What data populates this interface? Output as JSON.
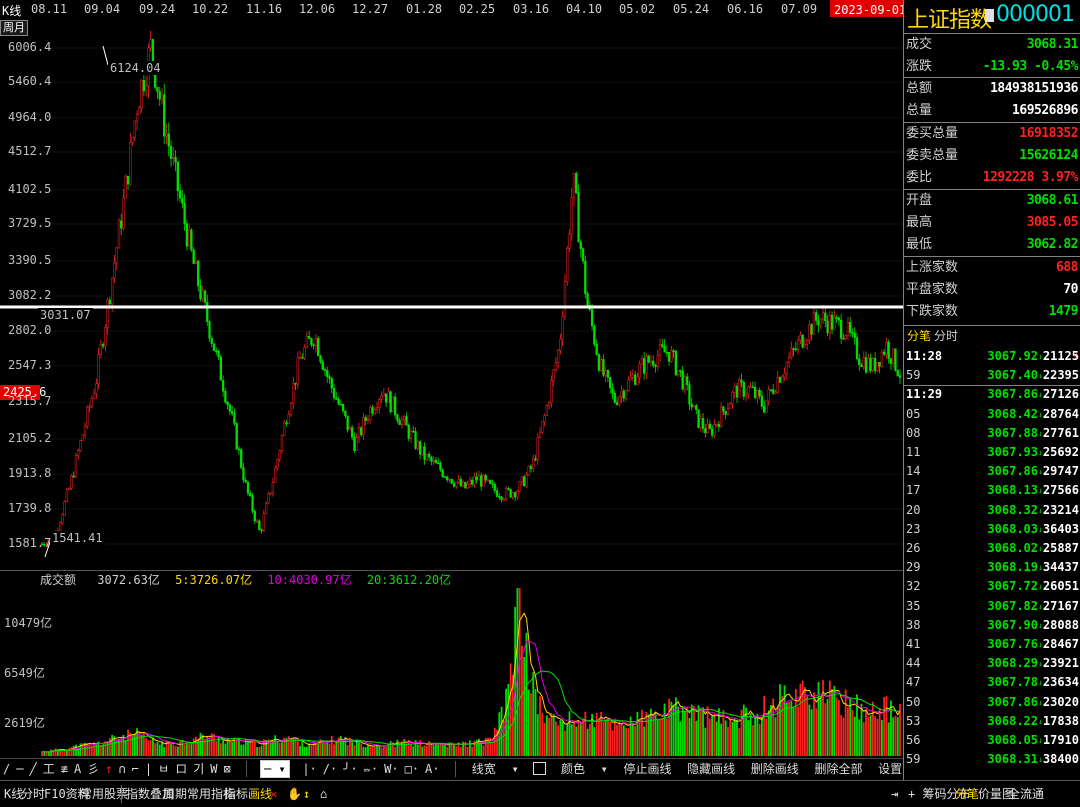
{
  "header": {
    "k_label": "K线",
    "dates": [
      "08.11",
      "09.04",
      "09.24",
      "10.22",
      "11.16",
      "12.06",
      "12.27",
      "01.28",
      "02.25",
      "03.16",
      "04.10",
      "05.02",
      "05.24",
      "06.16",
      "07.09"
    ],
    "date_stamp": "2023-09-01 五",
    "period_label": "周月"
  },
  "chart_data": [
    {
      "type": "candlestick",
      "y_ticks": [
        "6006.4",
        "5460.4",
        "4964.0",
        "4512.7",
        "4102.5",
        "3729.5",
        "3390.5",
        "3082.2",
        "2802.0",
        "2547.3",
        "2315.7",
        "2105.2",
        "1913.8",
        "1739.8",
        "1581.7"
      ],
      "high_label": "6124.04",
      "low_label": "1541.41",
      "line_label": "3031.07",
      "current_label": "2425.6",
      "h_line_value": 3031.07,
      "close_series": [
        1600,
        1700,
        2100,
        2600,
        3100,
        3900,
        4700,
        5600,
        6100,
        5400,
        4800,
        4200,
        3700,
        3200,
        2700,
        2100,
        1700,
        2200,
        2800,
        3300,
        3500,
        3100,
        2800,
        2500,
        2800,
        3000,
        2800,
        2600,
        2400,
        2300,
        2200,
        2100,
        2200,
        2100,
        2050,
        2100,
        2300,
        2800,
        3400,
        4900,
        3800,
        3200,
        2900,
        3050,
        3200,
        3300,
        3350,
        3100,
        2750,
        2600,
        2800,
        3000,
        3000,
        2850,
        3100,
        3300,
        3500,
        3650,
        3600,
        3550,
        3300,
        3200,
        3400,
        3150
      ]
    },
    {
      "type": "bar",
      "title": "成交额",
      "current": "3072.63亿",
      "ma5": "5:3726.07亿",
      "ma10": "10:4030.97亿",
      "ma20": "20:3612.20亿",
      "y_ticks": [
        "10479亿",
        "6549亿",
        "2619亿"
      ],
      "volume_series": [
        300,
        450,
        600,
        800,
        900,
        1200,
        1500,
        1600,
        1100,
        900,
        1000,
        1200,
        1500,
        1300,
        1100,
        1000,
        900,
        1200,
        1400,
        1000,
        900,
        1100,
        1300,
        1000,
        900,
        800,
        950,
        1000,
        900,
        850,
        800,
        900,
        1000,
        1200,
        3500,
        11500,
        5000,
        2800,
        2500,
        2600,
        2700,
        2600,
        2400,
        2500,
        2700,
        3000,
        3300,
        3500,
        3200,
        2900,
        2700,
        2800,
        3100,
        3500,
        4200,
        4600,
        4800,
        4500,
        4300,
        3900,
        3600,
        3300,
        3500,
        3000
      ]
    }
  ],
  "draw_toolbar": {
    "tools": [
      "/",
      "─",
      "╱",
      "工",
      "≢",
      "A",
      "彡",
      "↑",
      "∩",
      "⌐",
      "|",
      "ㅂ",
      "ロ",
      "기",
      "W",
      "⊠"
    ],
    "line_type": "─",
    "style_tools": [
      "|",
      "/",
      "╯",
      "✏",
      "W",
      "□",
      "A"
    ],
    "line_width": "线宽",
    "color": "颜色",
    "stop": "停止画线",
    "hide": "隐藏画线",
    "delete": "删除画线",
    "delete_all": "删除全部",
    "settings": "设置(S)"
  },
  "bottom_bar": {
    "left_tabs": [
      "K线",
      "分时",
      "F10资料",
      "常用股票"
    ],
    "mid_tabs": [
      "指数叠加",
      "周期",
      "常用指标",
      "指标",
      "画线"
    ],
    "right_tabs": [
      "筹码分布",
      "分笔",
      "价量图",
      "全流通"
    ]
  },
  "panel": {
    "name": "上证指数",
    "code": "000001",
    "rows1": [
      {
        "k": "成交",
        "v": "3068.31",
        "c": "green"
      },
      {
        "k": "涨跌",
        "v": "-13.93  -0.45%",
        "c": "green"
      }
    ],
    "rows2": [
      {
        "k": "总额",
        "v": "184938151936",
        "c": "white"
      },
      {
        "k": "总量",
        "v": "169526896",
        "c": "white"
      }
    ],
    "rows3": [
      {
        "k": "委买总量",
        "v": "16918352",
        "c": "red"
      },
      {
        "k": "委卖总量",
        "v": "15626124",
        "c": "green"
      },
      {
        "k": "委比",
        "v": "1292228 3.97%",
        "c": "red"
      }
    ],
    "rows4": [
      {
        "k": "开盘",
        "v": "3068.61",
        "c": "green"
      },
      {
        "k": "最高",
        "v": "3085.05",
        "c": "red"
      },
      {
        "k": "最低",
        "v": "3062.82",
        "c": "green"
      }
    ],
    "rows5": [
      {
        "k": "上涨家数",
        "v": "688",
        "c": "red"
      },
      {
        "k": "平盘家数",
        "v": "70",
        "c": "white"
      },
      {
        "k": "下跌家数",
        "v": "1479",
        "c": "green"
      }
    ],
    "tab1": "分笔",
    "tab2": "分时",
    "ticks": [
      {
        "t": "11:28",
        "p": "3067.92",
        "v": "21125",
        "big": true
      },
      {
        "t": "59",
        "p": "3067.40",
        "v": "22395",
        "big": false
      },
      {
        "t": "11:29",
        "p": "3067.86",
        "v": "27126",
        "big": true
      },
      {
        "t": "05",
        "p": "3068.42",
        "v": "28764",
        "big": false
      },
      {
        "t": "08",
        "p": "3067.88",
        "v": "27761",
        "big": false
      },
      {
        "t": "11",
        "p": "3067.93",
        "v": "25692",
        "big": false
      },
      {
        "t": "14",
        "p": "3067.86",
        "v": "29747",
        "big": false
      },
      {
        "t": "17",
        "p": "3068.13",
        "v": "27566",
        "big": false
      },
      {
        "t": "20",
        "p": "3068.32",
        "v": "23214",
        "big": false
      },
      {
        "t": "23",
        "p": "3068.03",
        "v": "36403",
        "big": false
      },
      {
        "t": "26",
        "p": "3068.02",
        "v": "25887",
        "big": false
      },
      {
        "t": "29",
        "p": "3068.19",
        "v": "34437",
        "big": false
      },
      {
        "t": "32",
        "p": "3067.72",
        "v": "26051",
        "big": false
      },
      {
        "t": "35",
        "p": "3067.82",
        "v": "27167",
        "big": false
      },
      {
        "t": "38",
        "p": "3067.90",
        "v": "28088",
        "big": false
      },
      {
        "t": "41",
        "p": "3067.76",
        "v": "28467",
        "big": false
      },
      {
        "t": "44",
        "p": "3068.29",
        "v": "23921",
        "big": false
      },
      {
        "t": "47",
        "p": "3067.78",
        "v": "23634",
        "big": false
      },
      {
        "t": "50",
        "p": "3067.86",
        "v": "23020",
        "big": false
      },
      {
        "t": "53",
        "p": "3068.22",
        "v": "17838",
        "big": false
      },
      {
        "t": "56",
        "p": "3068.05",
        "v": "17910",
        "big": false
      },
      {
        "t": "59",
        "p": "3068.31",
        "v": "38400",
        "big": false
      }
    ]
  },
  "colors": {
    "up": "#ff2020",
    "down": "#00e000",
    "accent": "#ffd700",
    "cyan": "#00e0e0"
  }
}
